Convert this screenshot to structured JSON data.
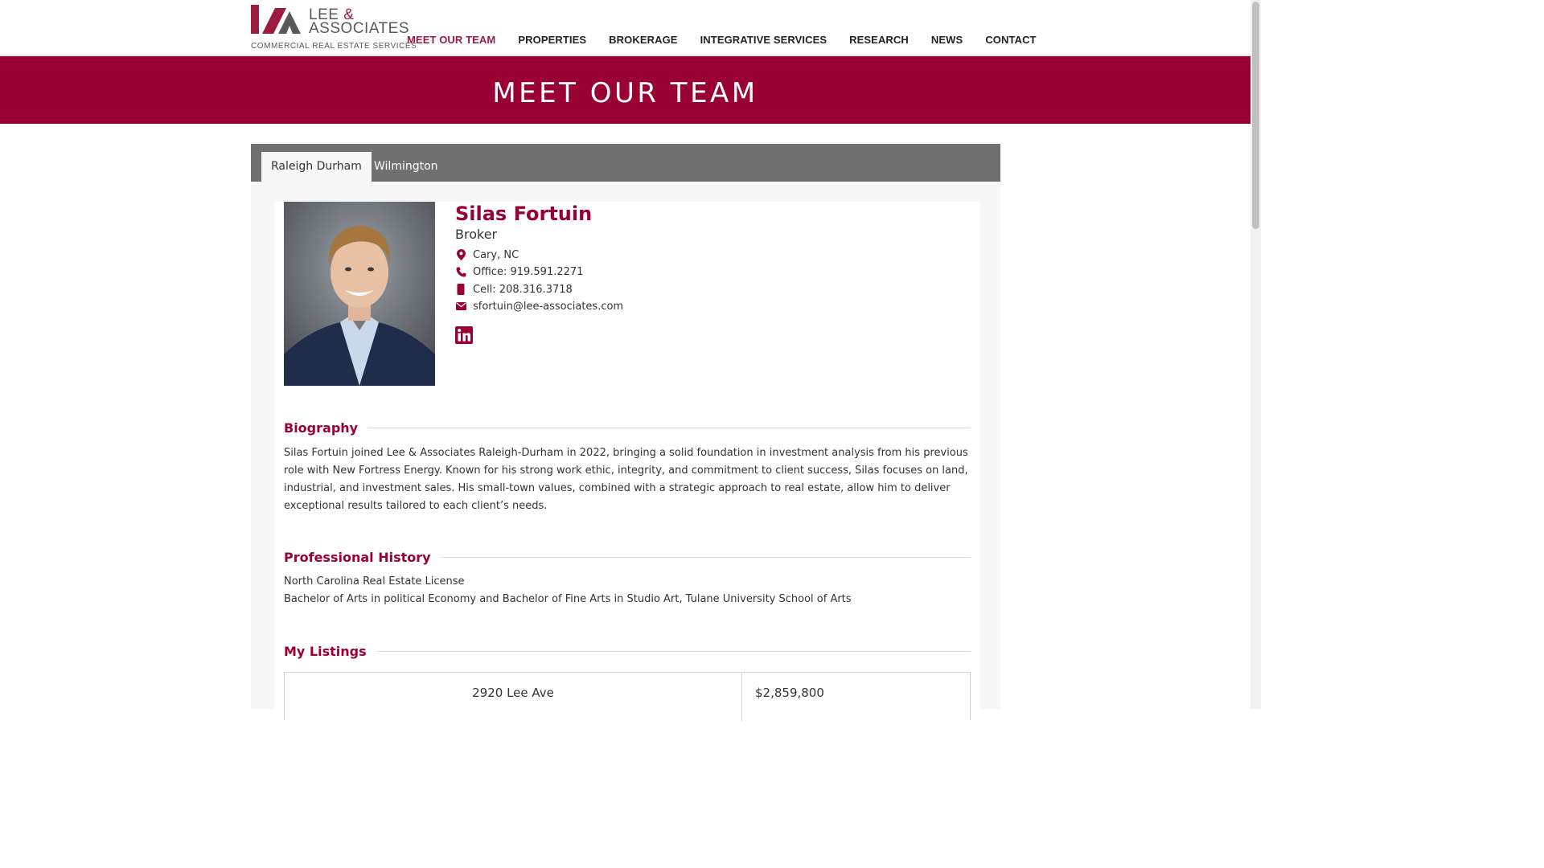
{
  "header": {
    "logo": {
      "line1": "LEE ",
      "amp": "&",
      "line2": "ASSOCIATES",
      "tagline": "COMMERCIAL REAL ESTATE SERVICES"
    },
    "nav": [
      {
        "label": "MEET OUR TEAM",
        "active": true
      },
      {
        "label": "PROPERTIES",
        "active": false
      },
      {
        "label": "BROKERAGE",
        "active": false
      },
      {
        "label": "INTEGRATIVE SERVICES",
        "active": false
      },
      {
        "label": "RESEARCH",
        "active": false
      },
      {
        "label": "NEWS",
        "active": false
      },
      {
        "label": "CONTACT",
        "active": false
      }
    ]
  },
  "banner": {
    "title": "MEET OUR TEAM"
  },
  "tabs": [
    {
      "label": "Raleigh Durham",
      "active": true
    },
    {
      "label": "Wilmington",
      "active": false
    }
  ],
  "agent": {
    "name": "Silas Fortuin",
    "title": "Broker",
    "location": "Cary, NC",
    "office": "Office: 919.591.2271",
    "cell": "Cell: 208.316.3718",
    "email": "sfortuin@lee-associates.com",
    "social": [
      "linkedin-icon"
    ]
  },
  "sections": {
    "biography": {
      "title": "Biography",
      "text": "Silas Fortuin joined Lee & Associates Raleigh-Durham in 2022, bringing a solid foundation in investment analysis from his previous role with New Fortress Energy. Known for his strong work ethic, integrity, and commitment to client success, Silas focuses on land, industrial, and investment sales. His small-town values, combined with a strategic approach to real estate, allow him to deliver exceptional results tailored to each client’s needs."
    },
    "history": {
      "title": "Professional History",
      "lines": [
        "North Carolina Real Estate License",
        "Bachelor of Arts in political Economy and Bachelor of Fine Arts in Studio Art, Tulane University School of Arts"
      ]
    },
    "listings": {
      "title": "My Listings",
      "items": [
        {
          "address": "2920 Lee Ave",
          "price": "$2,859,800"
        }
      ]
    }
  },
  "colors": {
    "brand": "#990033",
    "tab_bar": "#707070",
    "panel": "#f7f7f7"
  }
}
